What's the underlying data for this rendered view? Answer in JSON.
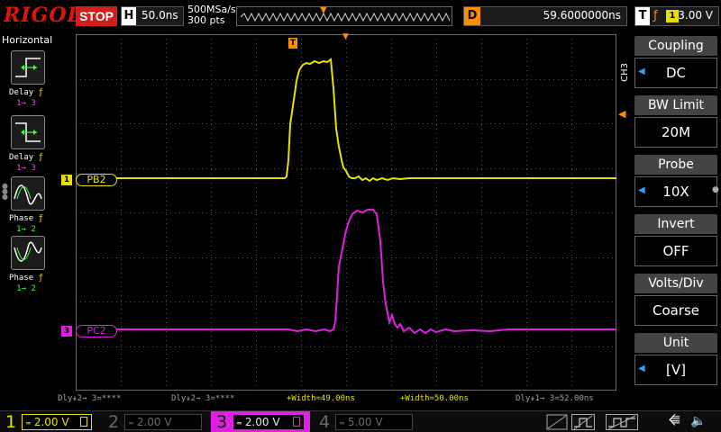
{
  "topbar": {
    "brand": "RIGOL",
    "run_state": "STOP",
    "horizontal_key": "H",
    "timebase": "50.0ns",
    "sample_rate": "500MSa/s",
    "memory_depth": "300 pts",
    "delay_key": "D",
    "delay_value": "59.6000000ns",
    "trigger_key": "T",
    "trigger_source": "1",
    "trigger_level": "3.00 V"
  },
  "left_panel": {
    "title": "Horizontal",
    "items": [
      {
        "label": "Delay",
        "sub": "1→ 3"
      },
      {
        "label": "Delay",
        "sub": "1→ 3"
      },
      {
        "label": "Phase",
        "sub": "1→ 2"
      },
      {
        "label": "Phase",
        "sub": "1→ 2"
      }
    ]
  },
  "channels": {
    "ch1": {
      "marker": "1",
      "name": "PB2",
      "color": "#e8e000"
    },
    "ch3": {
      "marker": "3",
      "name": "PC2",
      "color": "#e020e0"
    }
  },
  "trigger_marker": "T",
  "measurements": [
    {
      "text": "Dly↡2→ 3=****",
      "color": "grey"
    },
    {
      "text": "Dly↡2→ 3=****",
      "color": "grey"
    },
    {
      "text": "+Width=49.00ns",
      "color": "yellow"
    },
    {
      "text": "+Width=50.00ns",
      "color": "yellow"
    },
    {
      "text": "Dly↡1→ 3=52.00ns",
      "color": "grey"
    }
  ],
  "right_panel": {
    "channel_label": "CH3",
    "items": [
      {
        "title": "Coupling",
        "value": "DC",
        "arrow": true
      },
      {
        "title": "BW Limit",
        "value": "20M",
        "arrow": false
      },
      {
        "title": "Probe",
        "value": "10X",
        "arrow": true
      },
      {
        "title": "Invert",
        "value": "OFF",
        "arrow": false
      },
      {
        "title": "Volts/Div",
        "value": "Coarse",
        "arrow": false
      },
      {
        "title": "Unit",
        "value": "[V]",
        "arrow": true
      }
    ]
  },
  "statusbar": {
    "ch1": {
      "num": "1",
      "scale": "2.00 V"
    },
    "ch2": {
      "num": "2",
      "scale": "2.00 V"
    },
    "ch3": {
      "num": "3",
      "scale": "2.00 V"
    },
    "ch4": {
      "num": "4",
      "scale": "5.00 V"
    }
  },
  "colors": {
    "ch1": "#e8e000",
    "ch3": "#e020e0",
    "trigger": "#ff8c00",
    "brand": "#e0140f"
  },
  "icons": [
    "delay-rise-icon",
    "delay-fall-icon",
    "phase-icon",
    "usb-icon",
    "speaker-muted-icon"
  ]
}
